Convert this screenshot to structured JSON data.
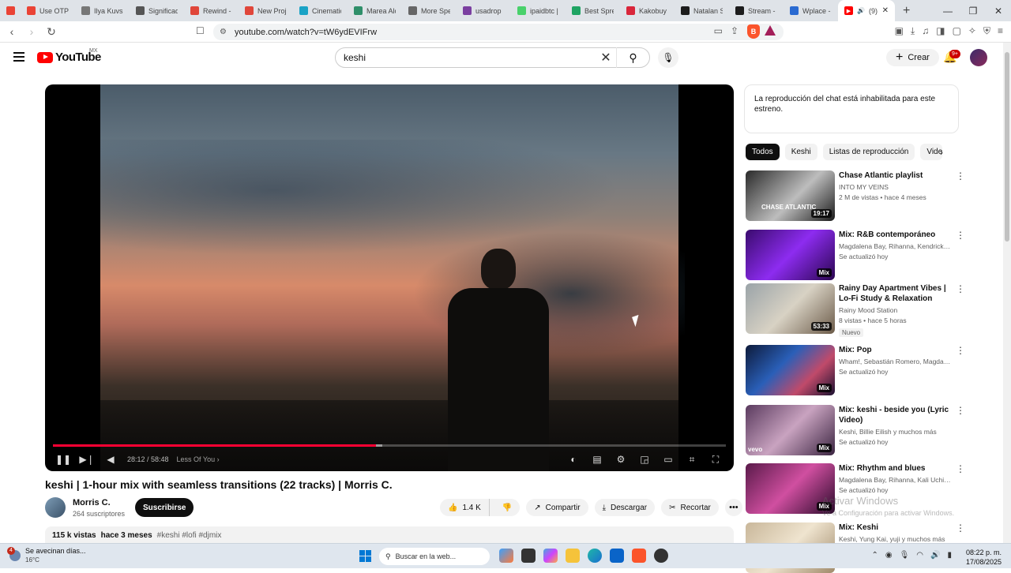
{
  "browser": {
    "tabs": [
      {
        "label": "",
        "color": "#ea4335",
        "icon": "gmail-icon"
      },
      {
        "label": "Use OTP",
        "color": "#ea4335",
        "icon": "gmail-icon"
      },
      {
        "label": "Ilya Kuvsh",
        "color": "#777777",
        "icon": "handshake-icon"
      },
      {
        "label": "Significad",
        "color": "#555555",
        "icon": "openai-icon"
      },
      {
        "label": "Rewind -",
        "color": "#e0463a",
        "icon": "record-icon"
      },
      {
        "label": "New Proj",
        "color": "#e0463a",
        "icon": "record-icon"
      },
      {
        "label": "Cinematic",
        "color": "#1aa3c6",
        "icon": "film-icon"
      },
      {
        "label": "Marea Alc",
        "color": "#2f8f6a",
        "icon": "grid-icon"
      },
      {
        "label": "More Spe",
        "color": "#666666",
        "icon": "cloud-icon"
      },
      {
        "label": "usadrop",
        "color": "#7b3fa0",
        "icon": "usadrop-icon"
      },
      {
        "label": "ipaidbtc |",
        "color": "#49d16b",
        "icon": "figure-icon"
      },
      {
        "label": "Best Spre",
        "color": "#1fa463",
        "icon": "sheets-icon"
      },
      {
        "label": "Kakobuy",
        "color": "#d9263a",
        "icon": "k-icon"
      },
      {
        "label": "Natalan S",
        "color": "#1c1c1c",
        "icon": "k-green-icon"
      },
      {
        "label": "Stream -",
        "color": "#1c1c1c",
        "icon": "k-green-icon"
      },
      {
        "label": "Wplace -",
        "color": "#2a6ad1",
        "icon": "globe-icon"
      }
    ],
    "active_tab": {
      "count": "(9)",
      "close": "✕"
    },
    "url": "youtube.com/watch?v=tW6ydEVIFrw"
  },
  "header": {
    "logo_text": "YouTube",
    "region": "MX",
    "search_value": "keshi",
    "create_label": "Crear",
    "notifications": "9+"
  },
  "video": {
    "title": "keshi | 1-hour mix with seamless transitions (22 tracks) | Morris C.",
    "time": "28:12 / 58:48",
    "chapter": "Less Of You ›",
    "progress_fraction": 0.48,
    "buffer_fraction": 0.49,
    "channel": "Morris C.",
    "subscribers": "264 suscriptores",
    "subscribe_label": "Suscribirse",
    "likes": "1.4 K",
    "share_label": "Compartir",
    "download_label": "Descargar",
    "clip_label": "Recortar",
    "views": "115 k vistas",
    "uploaded": "hace 3 meses",
    "tags": "#keshi #lofi #djmix"
  },
  "sidebar": {
    "chat_notice": "La reproducción del chat está inhabilitada para este estreno.",
    "chips": [
      "Todos",
      "Keshi",
      "Listas de reproducción",
      "Videos"
    ],
    "recs": [
      {
        "title": "Chase Atlantic playlist",
        "sub": "INTO MY VEINS",
        "info": "2 M de vistas • hace 4 meses",
        "badge": "19:17",
        "thumb_text": "CHASE ATLANTIC",
        "bg": "linear-gradient(135deg,#2a2a2a,#bdbdbd 55%,#1a1a1a)"
      },
      {
        "title": "Mix: R&B contemporáneo",
        "sub": "Magdalena Bay, Rihanna, Kendrick Lamar y más",
        "info": "Se actualizó hoy",
        "badge": "Mix",
        "bg": "linear-gradient(135deg,#3a0b6e,#8d2cf0 50%,#2a0650)"
      },
      {
        "title": "Rainy Day Apartment Vibes | Lo-Fi Study & Relaxation Music",
        "sub": "Rainy Mood Station",
        "info": "8 vistas • hace 5 horas",
        "badge": "53:33",
        "nuevo": "Nuevo",
        "bg": "linear-gradient(135deg,#9aa3a8,#d8d2c4 50%,#6b5a48)"
      },
      {
        "title": "Mix: Pop",
        "sub": "Wham!, Sebastián Romero, Magdalena Bay y más",
        "info": "Se actualizó hoy",
        "badge": "Mix",
        "bg": "linear-gradient(135deg,#0d1a3a,#2a5fb8 40%,#c04a6a 70%,#1a1030)"
      },
      {
        "title": "Mix: keshi - beside you (Lyric Video)",
        "sub": "Keshi, Billie Eilish y muchos más",
        "info": "Se actualizó hoy",
        "badge": "Mix",
        "vevo": "vevo",
        "bg": "linear-gradient(135deg,#5a3a5e,#c9a3c0 50%,#3a2440)"
      },
      {
        "title": "Mix: Rhythm and blues",
        "sub": "Magdalena Bay, Rihanna, Kali Uchis y muchos más",
        "info": "Se actualizó hoy",
        "badge": "Mix",
        "bg": "linear-gradient(135deg,#5a1a4a,#d04fa0 50%,#2a0a2a)"
      },
      {
        "title": "Mix: Keshi",
        "sub": "Keshi, Yung Kai, yuji y muchos más",
        "info": "",
        "badge": "",
        "bg": "linear-gradient(135deg,#c9b79a,#efe4cf 50%,#a08a6a)"
      }
    ]
  },
  "watermark": {
    "line1": "Activar Windows",
    "line2": "Ve a Configuración para activar Windows."
  },
  "taskbar": {
    "weather_title": "Se avecinan días...",
    "weather_temp": "16°C",
    "weather_badge": "4",
    "search_placeholder": "Buscar en la web...",
    "time": "08:22 p. m.",
    "date": "17/08/2025"
  }
}
